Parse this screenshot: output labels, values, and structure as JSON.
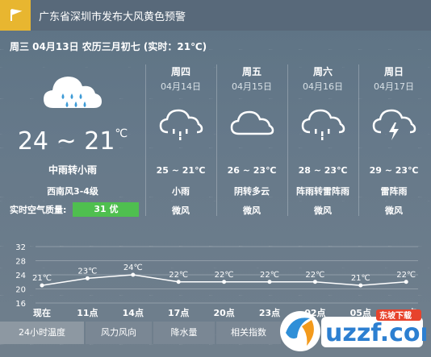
{
  "alert": {
    "text": "广东省深圳市发布大风黄色预警",
    "color": "#e8b630"
  },
  "date_line": "周三 04月13日 农历三月初七 (实时：21℃)",
  "today": {
    "temp": "24 ~ 21",
    "unit": "℃",
    "condition": "中雨转小雨",
    "wind": "西南风3-4级",
    "air_quality_label": "实时空气质量:",
    "air_quality_value": "31 优",
    "air_quality_color": "#4fbf4f"
  },
  "forecast": [
    {
      "weekday": "周四",
      "date": "04月14日",
      "icon": "rain-cloud-icon",
      "temp": "25 ~ 21℃",
      "condition": "小雨",
      "wind": "微风"
    },
    {
      "weekday": "周五",
      "date": "04月15日",
      "icon": "cloud-icon",
      "temp": "26 ~ 23℃",
      "condition": "阴转多云",
      "wind": "微风"
    },
    {
      "weekday": "周六",
      "date": "04月16日",
      "icon": "rain-cloud-icon",
      "temp": "28 ~ 23℃",
      "condition": "阵雨转雷阵雨",
      "wind": "微风"
    },
    {
      "weekday": "周日",
      "date": "04月17日",
      "icon": "thunder-cloud-icon",
      "temp": "29 ~ 23℃",
      "condition": "雷阵雨",
      "wind": "微风"
    }
  ],
  "chart_data": {
    "type": "line",
    "categories": [
      "现在",
      "11点",
      "14点",
      "17点",
      "20点",
      "23点",
      "02点",
      "05点",
      "08点"
    ],
    "series": [
      {
        "values": [
          21,
          23,
          24,
          22,
          22,
          22,
          22,
          21,
          22
        ],
        "labels": [
          "21℃",
          "23℃",
          "24℃",
          "22℃",
          "22℃",
          "22℃",
          "22℃",
          "21℃",
          "22℃"
        ]
      }
    ],
    "yticks": [
      16,
      20,
      24,
      28,
      32
    ],
    "ylim": [
      16,
      32
    ],
    "grid": true
  },
  "tabs": [
    "24小时温度",
    "风力风向",
    "降水量",
    "相关指数"
  ],
  "watermark": {
    "text": "uzzf.com",
    "sub": "东坡下载"
  }
}
